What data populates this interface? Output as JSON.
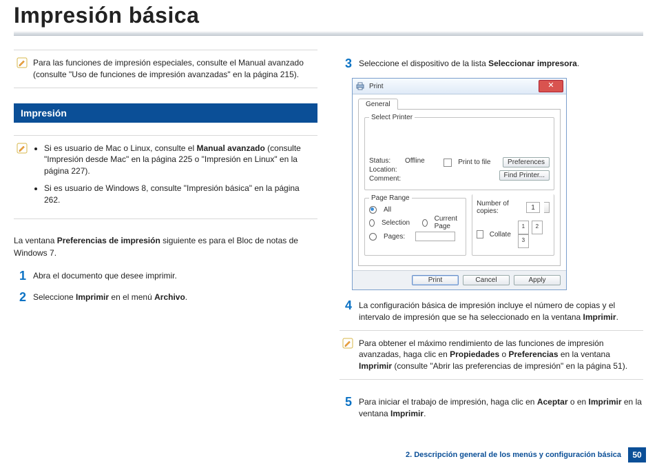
{
  "title": "Impresión básica",
  "note_top": "Para las funciones de impresión especiales, consulte el Manual avanzado (consulte \"Uso de funciones de impresión avanzadas\" en la página 215).",
  "section_heading": "Impresión",
  "note_bullets": {
    "b0_a": "Si es usuario de Mac o Linux, consulte el ",
    "b0_b": "Manual avanzado",
    "b0_c": " (consulte \"Impresión desde Mac\" en la página 225 o \"Impresión en Linux\" en la página 227).",
    "b1": "Si es usuario de Windows 8, consulte \"Impresión básica\" en la página 262."
  },
  "intro_a": "La ventana ",
  "intro_b": "Preferencias de impresión",
  "intro_c": " siguiente es para el Bloc de notas de Windows 7.",
  "steps": {
    "s1": "Abra el documento que desee imprimir.",
    "s2_a": "Seleccione ",
    "s2_b": "Imprimir",
    "s2_c": " en el menú ",
    "s2_d": "Archivo",
    "s2_e": ".",
    "s3_a": "Seleccione el dispositivo de la lista ",
    "s3_b": "Seleccionar impresora",
    "s3_c": ".",
    "s4_a": "La configuración básica de impresión incluye el número de copias y el intervalo de impresión que se ha seleccionado en la ventana ",
    "s4_b": "Imprimir",
    "s4_c": ".",
    "s5_a": "Para iniciar el trabajo de impresión, haga clic en ",
    "s5_b": "Aceptar",
    "s5_c": " o en ",
    "s5_d": "Imprimir",
    "s5_e": " en la ventana ",
    "s5_f": "Imprimir",
    "s5_g": "."
  },
  "note_mid_a": "Para obtener el máximo rendimiento de las funciones de impresión avanzadas, haga clic en ",
  "note_mid_b": "Propiedades",
  "note_mid_c": " o ",
  "note_mid_d": "Preferencias",
  "note_mid_e": " en la ventana ",
  "note_mid_f": "Imprimir",
  "note_mid_g": " (consulte \"Abrir las preferencias de impresión\" en la página 51).",
  "dialog": {
    "title": "Print",
    "tab": "General",
    "group_printer": "Select Printer",
    "status_lbl": "Status:",
    "status_val": "Offline",
    "location_lbl": "Location:",
    "comment_lbl": "Comment:",
    "print_to_file": "Print to file",
    "btn_prefs": "Preferences",
    "btn_find": "Find Printer...",
    "group_range": "Page Range",
    "opt_all": "All",
    "opt_selection": "Selection",
    "opt_current": "Current Page",
    "opt_pages": "Pages:",
    "copies_lbl": "Number of copies:",
    "copies_val": "1",
    "collate": "Collate",
    "stack1": "1",
    "stack2": "2",
    "stack3": "3",
    "btn_print": "Print",
    "btn_cancel": "Cancel",
    "btn_apply": "Apply"
  },
  "footer": {
    "chapter": "2. Descripción general de los menús y configuración básica",
    "page": "50"
  },
  "nums": {
    "n1": "1",
    "n2": "2",
    "n3": "3",
    "n4": "4",
    "n5": "5"
  }
}
